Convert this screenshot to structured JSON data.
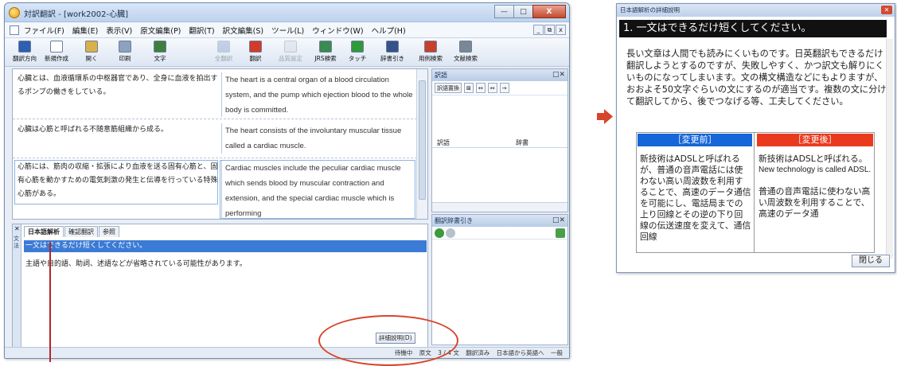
{
  "window": {
    "title": "対訳翻訳 - [work2002-心臓]",
    "buttons": {
      "minimize": "—",
      "maximize": "□",
      "close": "X"
    }
  },
  "menubar": {
    "items": [
      "ファイル(F)",
      "編集(E)",
      "表示(V)",
      "原文編集(P)",
      "翻訳(T)",
      "訳文編集(S)",
      "ツール(L)",
      "ウィンドウ(W)",
      "ヘルプ(H)"
    ],
    "mdi": [
      "_",
      "⧉",
      "x"
    ]
  },
  "toolbar": {
    "items": [
      {
        "label": "翻訳方向",
        "color": "#2d5fb2",
        "enabled": true
      },
      {
        "label": "新規作成",
        "color": "#ffffff",
        "enabled": true
      },
      {
        "label": "開く",
        "color": "#d9b04a",
        "enabled": true
      },
      {
        "label": "印刷",
        "color": "#8da2c0",
        "enabled": true
      },
      {
        "label": "文字",
        "color": "#3e7f3e",
        "enabled": true
      },
      {
        "label": "全翻訳",
        "color": "#6a8cc8",
        "enabled": false
      },
      {
        "label": "翻訳",
        "color": "#d33a2a",
        "enabled": true
      },
      {
        "label": "品質設定",
        "color": "#c9d3e3",
        "enabled": false
      },
      {
        "label": "JRS検索",
        "color": "#3a8a52",
        "enabled": true
      },
      {
        "label": "タッチ",
        "color": "#2e9a3a",
        "enabled": true
      },
      {
        "label": "辞書引き",
        "color": "#35528a",
        "enabled": true
      },
      {
        "label": "用例検索",
        "color": "#c8402b",
        "enabled": true
      },
      {
        "label": "文献検索",
        "color": "#7a8896",
        "enabled": true
      }
    ]
  },
  "grid": {
    "rows": [
      {
        "ja": "心臓とは、血液循環系の中枢器官であり、全身に血液を拍出するポンプの働きをしている。",
        "en": "The heart is a central organ of a blood circulation system, and the pump which ejection blood to the whole body is committed."
      },
      {
        "ja": "心臓は心筋と呼ばれる不随意筋組織から成る。",
        "en": "The heart consists of the involuntary muscular tissue called a cardiac muscle."
      },
      {
        "ja": "心筋には、筋肉の収縮・拡張により血液を送る固有心筋と、固有心筋を動かすための電気刺激の発生と伝導を行っている特殊心筋がある。",
        "en": "Cardiac muscles include the peculiar cardiac muscle which sends blood by muscular contraction and extension, and the special cardiac muscle which is performing"
      }
    ]
  },
  "right_panel": {
    "top": {
      "title": "訳語",
      "tool_labels": [
        "訳語置換",
        "⊠",
        "↔",
        "↔",
        "→"
      ],
      "col_headers": [
        "訳語",
        "辞書"
      ]
    },
    "bottom": {
      "title": "翻訳辞書引き"
    }
  },
  "bottom_panel": {
    "side_label": "文法",
    "tabs": [
      "日本語解析",
      "確認翻訳",
      "参照"
    ],
    "highlight": "一文はできるだけ短くしてください。",
    "note": "主語や目的語、助詞、述語などが省略されている可能性があります。",
    "detail_button": "詳細説明(D)"
  },
  "statusbar": {
    "items": [
      "待機中",
      "原文",
      "3 / 4 文",
      "翻訳済み",
      "日本語から英語へ",
      "一般"
    ]
  },
  "dialog": {
    "title": "日本語解析の詳細説明",
    "heading": "1. 一文はできるだけ短くしてください。",
    "body": "長い文章は人間でも読みにくいものです。日英翻訳もできるだけ翻訳しようとするのですが、失敗しやすく、かつ訳文も解りにくいものになってしまいます。文の構文構造などにもよりますが、おおよそ50文字ぐらいの文にするのが適当です。複数の文に分けて翻訳してから、後でつなげる等、工夫してください。",
    "before_header": "［変更前］",
    "after_header": "［変更後］",
    "before_text": "新技術はADSLと呼ばれるが、普通の音声電話には使わない高い周波数を利用することで、高速のデータ通信を可能にし、電話局までの上り回線とその逆の下り回線の伝送速度を変えて、通信回線",
    "after_text_1": "新技術はADSLと呼ばれる。",
    "after_text_2": "New technology is called ADSL.",
    "after_text_3": "普通の音声電話に使わない高い周波数を利用することで、高速のデータ通",
    "close_button": "閉じる",
    "colors": {
      "before": "#1566d8",
      "after": "#ea3a1e"
    }
  }
}
